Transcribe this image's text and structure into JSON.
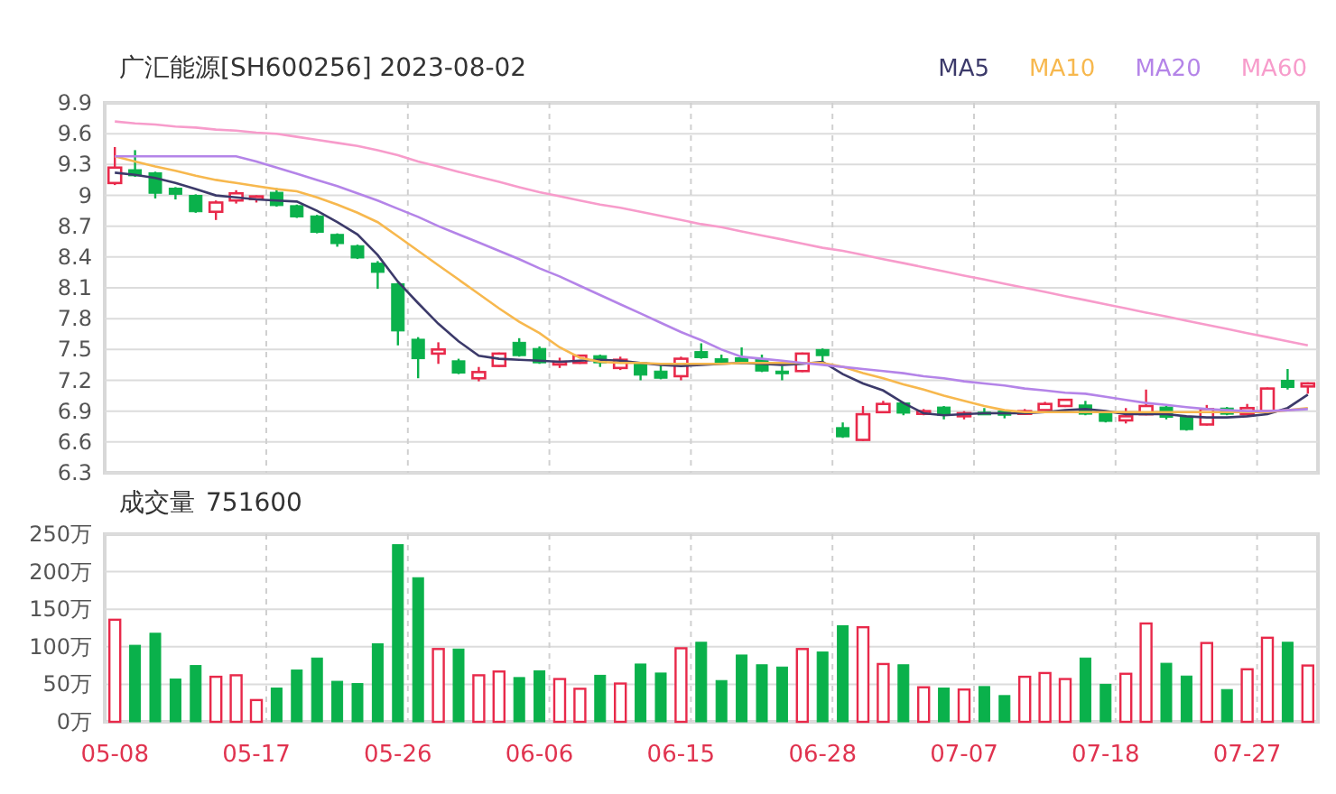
{
  "header": {
    "title": "广汇能源[SH600256] 2023-08-02"
  },
  "price_chart": {
    "chart_data": {
      "type": "candlestick",
      "grid": true,
      "categories": [
        null,
        null,
        null,
        null,
        null,
        null,
        null,
        null,
        null,
        null,
        null,
        null,
        null,
        null,
        null,
        null,
        null,
        null,
        null,
        null,
        null,
        null,
        null,
        null,
        null,
        null,
        null,
        null,
        null,
        null,
        null,
        null,
        null,
        null,
        null,
        null,
        null,
        null,
        null,
        null,
        null,
        null,
        null,
        null,
        null,
        null,
        null,
        null,
        null,
        null,
        null,
        null,
        null,
        null,
        null,
        null,
        null,
        null,
        null,
        null
      ],
      "ylim": [
        6.3,
        9.9
      ],
      "yticks": [
        9.9,
        9.6,
        9.3,
        9,
        8.7,
        8.4,
        8.1,
        7.8,
        7.5,
        7.2,
        6.9,
        6.6,
        6.3
      ],
      "ohlc": [
        [
          9.12,
          9.47,
          9.1,
          9.27
        ],
        [
          9.25,
          9.44,
          9.18,
          9.19
        ],
        [
          9.22,
          9.23,
          8.97,
          9.02
        ],
        [
          9.07,
          9.08,
          8.96,
          9.01
        ],
        [
          9.0,
          9.01,
          8.83,
          8.84
        ],
        [
          8.84,
          8.95,
          8.76,
          8.93
        ],
        [
          8.95,
          9.05,
          8.92,
          9.02
        ],
        [
          8.98,
          9.0,
          8.93,
          8.99
        ],
        [
          9.03,
          9.07,
          8.89,
          8.9
        ],
        [
          8.9,
          8.91,
          8.78,
          8.79
        ],
        [
          8.8,
          8.81,
          8.63,
          8.64
        ],
        [
          8.62,
          8.63,
          8.5,
          8.53
        ],
        [
          8.51,
          8.52,
          8.38,
          8.39
        ],
        [
          8.34,
          8.36,
          8.09,
          8.25
        ],
        [
          8.14,
          8.15,
          7.54,
          7.68
        ],
        [
          7.6,
          7.62,
          7.22,
          7.41
        ],
        [
          7.46,
          7.57,
          7.36,
          7.5
        ],
        [
          7.39,
          7.41,
          7.26,
          7.27
        ],
        [
          7.22,
          7.33,
          7.19,
          7.28
        ],
        [
          7.34,
          7.47,
          7.33,
          7.46
        ],
        [
          7.57,
          7.61,
          7.43,
          7.44
        ],
        [
          7.51,
          7.53,
          7.36,
          7.37
        ],
        [
          7.37,
          7.42,
          7.32,
          7.38
        ],
        [
          7.37,
          7.45,
          7.36,
          7.44
        ],
        [
          7.44,
          7.45,
          7.33,
          7.37
        ],
        [
          7.32,
          7.43,
          7.3,
          7.4
        ],
        [
          7.37,
          7.38,
          7.2,
          7.25
        ],
        [
          7.29,
          7.35,
          7.21,
          7.22
        ],
        [
          7.24,
          7.43,
          7.2,
          7.41
        ],
        [
          7.48,
          7.56,
          7.41,
          7.42
        ],
        [
          7.41,
          7.45,
          7.36,
          7.37
        ],
        [
          7.42,
          7.52,
          7.37,
          7.38
        ],
        [
          7.41,
          7.45,
          7.28,
          7.29
        ],
        [
          7.29,
          7.34,
          7.2,
          7.28
        ],
        [
          7.29,
          7.47,
          7.28,
          7.46
        ],
        [
          7.5,
          7.51,
          7.38,
          7.44
        ],
        [
          6.74,
          6.79,
          6.64,
          6.65
        ],
        [
          6.62,
          6.95,
          6.61,
          6.87
        ],
        [
          6.89,
          7.0,
          6.88,
          6.97
        ],
        [
          6.98,
          6.99,
          6.86,
          6.88
        ],
        [
          6.88,
          6.92,
          6.86,
          6.9
        ],
        [
          6.94,
          6.95,
          6.82,
          6.86
        ],
        [
          6.85,
          6.9,
          6.82,
          6.88
        ],
        [
          6.89,
          6.93,
          6.87,
          6.88
        ],
        [
          6.9,
          6.91,
          6.83,
          6.86
        ],
        [
          6.89,
          6.92,
          6.87,
          6.9
        ],
        [
          6.91,
          6.99,
          6.9,
          6.97
        ],
        [
          6.95,
          7.02,
          6.94,
          7.01
        ],
        [
          6.96,
          7.0,
          6.86,
          6.87
        ],
        [
          6.88,
          6.89,
          6.79,
          6.8
        ],
        [
          6.81,
          6.93,
          6.78,
          6.85
        ],
        [
          6.87,
          7.11,
          6.86,
          6.95
        ],
        [
          6.94,
          6.95,
          6.82,
          6.84
        ],
        [
          6.84,
          6.85,
          6.71,
          6.72
        ],
        [
          6.77,
          6.96,
          6.76,
          6.92
        ],
        [
          6.93,
          6.94,
          6.86,
          6.87
        ],
        [
          6.87,
          6.97,
          6.86,
          6.93
        ],
        [
          6.9,
          7.13,
          6.89,
          7.12
        ],
        [
          7.2,
          7.31,
          7.11,
          7.13
        ],
        [
          7.14,
          7.18,
          7.07,
          7.17
        ]
      ]
    }
  },
  "ma_chart": {
    "chart_data": {
      "type": "line",
      "categories": [
        null,
        null,
        null,
        null,
        null,
        null,
        null,
        null,
        null,
        null,
        null,
        null,
        null,
        null,
        null,
        null,
        null,
        null,
        null,
        null,
        null,
        null,
        null,
        null,
        null,
        null,
        null,
        null,
        null,
        null,
        null,
        null,
        null,
        null,
        null,
        null,
        null,
        null,
        null,
        null,
        null,
        null,
        null,
        null,
        null,
        null,
        null,
        null,
        null,
        null,
        null,
        null,
        null,
        null,
        null,
        null,
        null,
        null,
        null,
        null
      ],
      "ylim": [
        6.3,
        9.9
      ],
      "series": [
        {
          "name": "MA5",
          "color": "#3c3a6a",
          "values": [
            9.22,
            9.2,
            9.17,
            9.12,
            9.06,
            9.0,
            8.98,
            8.96,
            8.95,
            8.94,
            8.85,
            8.74,
            8.62,
            8.42,
            8.16,
            7.95,
            7.75,
            7.58,
            7.44,
            7.41,
            7.4,
            7.39,
            7.38,
            7.39,
            7.4,
            7.39,
            7.37,
            7.35,
            7.34,
            7.35,
            7.36,
            7.37,
            7.36,
            7.35,
            7.36,
            7.38,
            7.26,
            7.17,
            7.1,
            6.98,
            6.88,
            6.86,
            6.87,
            6.88,
            6.88,
            6.88,
            6.89,
            6.91,
            6.92,
            6.9,
            6.87,
            6.87,
            6.87,
            6.85,
            6.84,
            6.84,
            6.85,
            6.87,
            6.93,
            7.06
          ]
        },
        {
          "name": "MA10",
          "color": "#f7b84e",
          "values": [
            9.38,
            9.33,
            9.28,
            9.24,
            9.19,
            9.15,
            9.12,
            9.09,
            9.06,
            9.04,
            8.98,
            8.91,
            8.83,
            8.74,
            8.6,
            8.46,
            8.32,
            8.18,
            8.04,
            7.9,
            7.77,
            7.66,
            7.52,
            7.42,
            7.38,
            7.37,
            7.37,
            7.36,
            7.36,
            7.36,
            7.36,
            7.37,
            7.37,
            7.37,
            7.37,
            7.37,
            7.33,
            7.27,
            7.22,
            7.16,
            7.11,
            7.05,
            7.0,
            6.95,
            6.91,
            6.89,
            6.89,
            6.89,
            6.89,
            6.89,
            6.89,
            6.89,
            6.89,
            6.89,
            6.89,
            6.89,
            6.89,
            6.89,
            6.91,
            6.93
          ]
        },
        {
          "name": "MA20",
          "color": "#b484e8",
          "values": [
            9.38,
            9.38,
            9.38,
            9.38,
            9.38,
            9.38,
            9.38,
            9.33,
            9.27,
            9.21,
            9.15,
            9.09,
            9.02,
            8.95,
            8.87,
            8.79,
            8.7,
            8.62,
            8.54,
            8.46,
            8.38,
            8.29,
            8.21,
            8.12,
            8.03,
            7.94,
            7.85,
            7.76,
            7.67,
            7.59,
            7.5,
            7.43,
            7.41,
            7.39,
            7.37,
            7.35,
            7.33,
            7.31,
            7.29,
            7.27,
            7.24,
            7.22,
            7.19,
            7.17,
            7.15,
            7.12,
            7.1,
            7.08,
            7.07,
            7.04,
            7.01,
            6.98,
            6.96,
            6.94,
            6.92,
            6.91,
            6.9,
            6.9,
            6.91,
            6.92
          ]
        },
        {
          "name": "MA60",
          "color": "#f79ccb",
          "values": [
            9.72,
            9.7,
            9.69,
            9.67,
            9.66,
            9.64,
            9.63,
            9.61,
            9.6,
            9.57,
            9.54,
            9.51,
            9.48,
            9.44,
            9.39,
            9.33,
            9.28,
            9.23,
            9.18,
            9.13,
            9.08,
            9.03,
            8.99,
            8.95,
            8.91,
            8.88,
            8.84,
            8.8,
            8.76,
            8.72,
            8.69,
            8.65,
            8.61,
            8.57,
            8.53,
            8.49,
            8.46,
            8.42,
            8.38,
            8.34,
            8.3,
            8.26,
            8.22,
            8.18,
            8.14,
            8.1,
            8.06,
            8.02,
            7.98,
            7.94,
            7.9,
            7.86,
            7.82,
            7.78,
            7.74,
            7.7,
            7.66,
            7.62,
            7.58,
            7.54
          ]
        }
      ]
    }
  },
  "volume_header": {
    "value": "751600"
  },
  "volume_chart": {
    "chart_data": {
      "type": "bar",
      "grid": true,
      "categories": [
        "05-08",
        null,
        null,
        null,
        null,
        null,
        null,
        "05-17",
        null,
        null,
        null,
        null,
        null,
        null,
        "05-26",
        null,
        null,
        null,
        null,
        null,
        null,
        "06-06",
        null,
        null,
        null,
        null,
        null,
        null,
        "06-15",
        null,
        null,
        null,
        null,
        null,
        null,
        "06-28",
        null,
        null,
        null,
        null,
        null,
        null,
        "07-07",
        null,
        null,
        null,
        null,
        null,
        null,
        "07-18",
        null,
        null,
        null,
        null,
        null,
        null,
        "07-27",
        null,
        null,
        null
      ],
      "ylim": [
        0,
        250
      ],
      "yticks": [
        {
          "value": 250,
          "label": "250万"
        },
        {
          "value": 200,
          "label": "200万"
        },
        {
          "value": 150,
          "label": "150万"
        },
        {
          "value": 100,
          "label": "100万"
        },
        {
          "value": 50,
          "label": "50万"
        },
        {
          "value": 0,
          "label": "0万"
        }
      ],
      "series": [
        {
          "name": "成交量",
          "values": [
            136,
            102,
            118,
            57,
            75,
            60,
            62,
            29,
            45,
            69,
            85,
            54,
            51,
            104,
            236,
            192,
            97,
            97,
            62,
            67,
            59,
            68,
            57,
            44,
            62,
            51,
            77,
            65,
            98,
            106,
            55,
            89,
            76,
            73,
            97,
            93,
            128,
            126,
            77,
            76,
            46,
            45,
            43,
            47,
            35,
            60,
            65,
            57,
            85,
            50,
            64,
            131,
            78,
            61,
            105,
            43,
            70,
            112,
            106,
            75
          ]
        }
      ]
    }
  }
}
